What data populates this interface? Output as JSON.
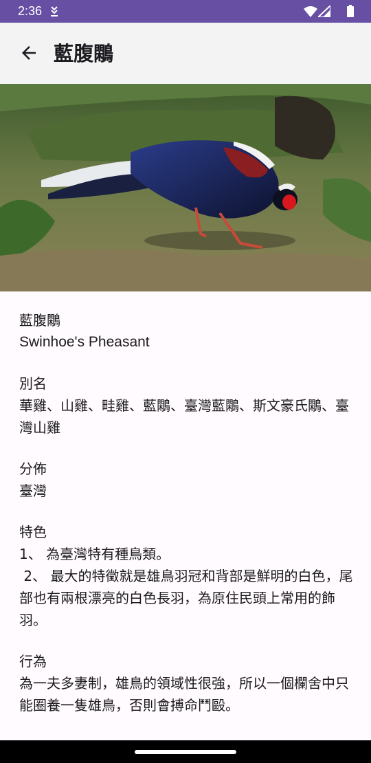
{
  "status_bar": {
    "time": "2:36",
    "background": "#6750a4",
    "icons": [
      "download-icon",
      "wifi-icon",
      "signal-icon",
      "battery-icon"
    ]
  },
  "app_bar": {
    "back_icon": "arrow-back-icon",
    "title": "藍腹鷴",
    "background": "#f3f3f3"
  },
  "hero_image": {
    "subject": "bird-photo"
  },
  "content": {
    "name_zh": "藍腹鷴",
    "name_en": "Swinhoe's Pheasant",
    "alias_heading": "別名",
    "alias_text": "華雞、山雞、畦雞、藍鷴、臺灣藍鷴、斯文豪氏鷴、臺灣山雞",
    "distribution_heading": "分佈",
    "distribution_text": "臺灣",
    "features_heading": "特色",
    "features_item1": "1、 為臺灣特有種鳥類。",
    "features_item2": " 2、 最大的特徵就是雄鳥羽冠和背部是鮮明的白色，尾部也有兩根漂亮的白色長羽，為原住民頭上常用的飾羽。",
    "behavior_heading": "行為",
    "behavior_text": "為一夫多妻制，雄鳥的領域性很強，所以一個欄舍中只能圈養一隻雄鳥，否則會搏命鬥毆。"
  },
  "nav_bar": {
    "handle": "gesture-handle"
  }
}
